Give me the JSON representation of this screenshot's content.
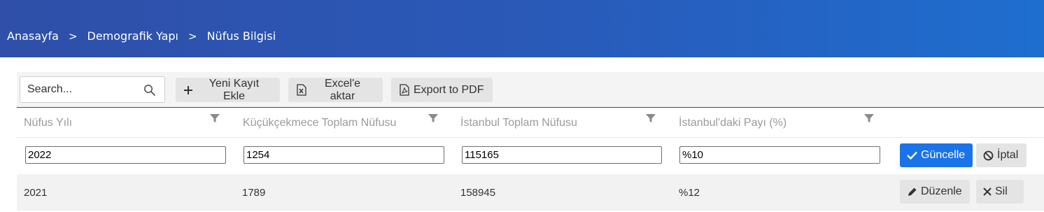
{
  "breadcrumb": {
    "items": [
      "Anasayfa",
      "Demografik Yapı",
      "Nüfus Bilgisi"
    ],
    "separator": ">"
  },
  "toolbar": {
    "search_placeholder": "Search...",
    "add_label": "Yeni Kayıt Ekle",
    "excel_label": "Excel'e aktar",
    "pdf_label": "Export to PDF"
  },
  "table": {
    "columns": [
      "Nüfus Yılı",
      "Küçükçekmece Toplam Nüfusu",
      "İstanbul Toplam Nüfusu",
      "İstanbul'daki Payı (%)"
    ],
    "edit_row": {
      "values": [
        "2022",
        "1254",
        "115165",
        "%10"
      ],
      "update_label": "Güncelle",
      "cancel_label": "İptal"
    },
    "rows": [
      {
        "values": [
          "2021",
          "1789",
          "158945",
          "%12"
        ],
        "edit_label": "Düzenle",
        "delete_label": "Sil"
      }
    ]
  },
  "colors": {
    "header_gradient_start": "#2f4fa8",
    "header_gradient_end": "#1e6ecf",
    "primary": "#1a73e8"
  }
}
